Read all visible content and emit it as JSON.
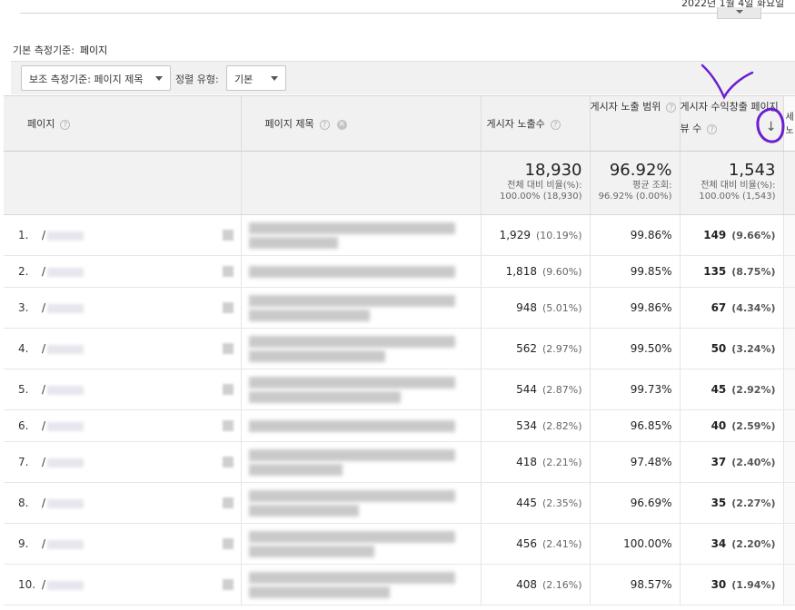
{
  "header": {
    "date_range": "2022년 1월 4일 화요일",
    "primary_dimension_label": "기본 측정기준:",
    "primary_dimension_value": "페이지"
  },
  "controls": {
    "secondary_dimension": "보조 측정기준: 페이지 제목",
    "sort_type_label": "정렬 유형:",
    "sort_type_value": "기본"
  },
  "table": {
    "columns": {
      "page": "페이지",
      "page_title": "페이지 제목",
      "impressions": "게시자 노출수",
      "coverage": "게시자 노출 범위",
      "monetized_pageviews": "게시자 수익창출 페이지뷰 수",
      "next_col_fragment": "세 노"
    },
    "totals": {
      "impressions": "18,930",
      "impressions_sub1": "전체 대비 비율(%):",
      "impressions_sub2": "100.00% (18,930)",
      "coverage": "96.92%",
      "coverage_sub1": "평균 조회:",
      "coverage_sub2": "96.92% (0.00%)",
      "monetized": "1,543",
      "monetized_sub1": "전체 대비 비율(%):",
      "monetized_sub2": "100.00% (1,543)"
    },
    "rows": [
      {
        "index": "1.",
        "slash": "/",
        "impressions": "1,929",
        "impressions_pct": "(10.19%)",
        "coverage": "99.86%",
        "monetized": "149",
        "monetized_pct": "(9.66%)"
      },
      {
        "index": "2.",
        "slash": "/",
        "impressions": "1,818",
        "impressions_pct": "(9.60%)",
        "coverage": "99.85%",
        "monetized": "135",
        "monetized_pct": "(8.75%)"
      },
      {
        "index": "3.",
        "slash": "/",
        "impressions": "948",
        "impressions_pct": "(5.01%)",
        "coverage": "99.86%",
        "monetized": "67",
        "monetized_pct": "(4.34%)"
      },
      {
        "index": "4.",
        "slash": "/",
        "impressions": "562",
        "impressions_pct": "(2.97%)",
        "coverage": "99.50%",
        "monetized": "50",
        "monetized_pct": "(3.24%)"
      },
      {
        "index": "5.",
        "slash": "/",
        "impressions": "544",
        "impressions_pct": "(2.87%)",
        "coverage": "99.73%",
        "monetized": "45",
        "monetized_pct": "(2.92%)"
      },
      {
        "index": "6.",
        "slash": "/",
        "impressions": "534",
        "impressions_pct": "(2.82%)",
        "coverage": "96.85%",
        "monetized": "40",
        "monetized_pct": "(2.59%)"
      },
      {
        "index": "7.",
        "slash": "/",
        "impressions": "418",
        "impressions_pct": "(2.21%)",
        "coverage": "97.48%",
        "monetized": "37",
        "monetized_pct": "(2.40%)"
      },
      {
        "index": "8.",
        "slash": "/",
        "impressions": "445",
        "impressions_pct": "(2.35%)",
        "coverage": "96.69%",
        "monetized": "35",
        "monetized_pct": "(2.27%)"
      },
      {
        "index": "9.",
        "slash": "/",
        "impressions": "456",
        "impressions_pct": "(2.41%)",
        "coverage": "100.00%",
        "monetized": "34",
        "monetized_pct": "(2.20%)"
      },
      {
        "index": "10.",
        "slash": "/",
        "impressions": "408",
        "impressions_pct": "(2.16%)",
        "coverage": "98.57%",
        "monetized": "30",
        "monetized_pct": "(1.94%)"
      }
    ]
  },
  "colors": {
    "annotation": "#6a1fd0",
    "header_bg": "#f1f1f1"
  }
}
